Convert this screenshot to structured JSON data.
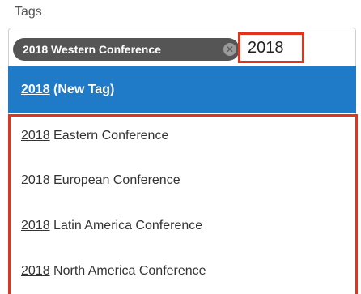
{
  "field": {
    "label": "Tags"
  },
  "selected_tags": [
    {
      "label": "2018 Western Conference",
      "remove_icon": "close-circle-icon"
    }
  ],
  "input": {
    "value": "2018"
  },
  "dropdown": {
    "new_tag": {
      "match": "2018",
      "rest": " (New Tag)"
    },
    "options": [
      {
        "match": "2018",
        "rest": " Eastern Conference"
      },
      {
        "match": "2018",
        "rest": " European Conference"
      },
      {
        "match": "2018",
        "rest": " Latin America Conference"
      },
      {
        "match": "2018",
        "rest": " North America Conference"
      }
    ]
  },
  "colors": {
    "highlight": "#1f7ac8",
    "annotation": "#e2331c",
    "chip": "#555555"
  }
}
